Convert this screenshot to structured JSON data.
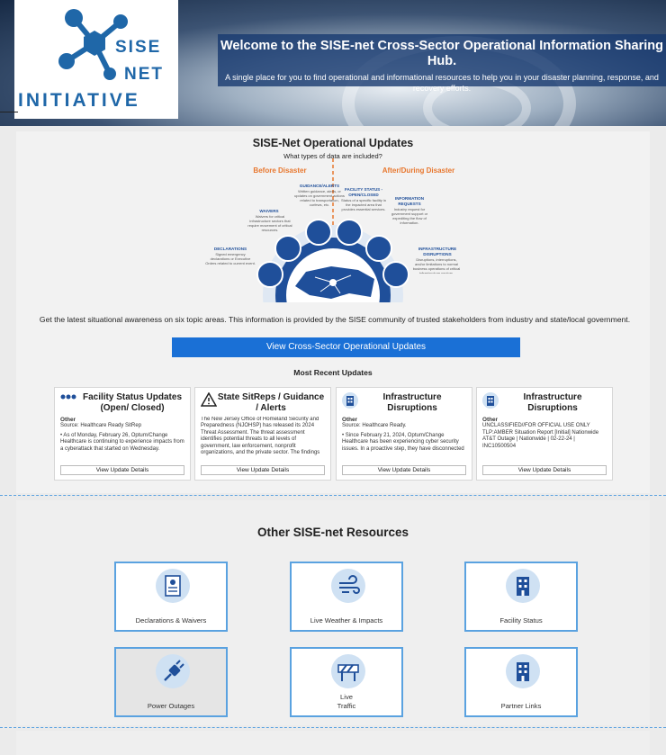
{
  "header": {
    "logo_line1": "SISE",
    "logo_line2": "NET",
    "logo_line3": "INITIATIVE",
    "title": "Welcome to the SISE-net Cross-Sector Operational Information Sharing Hub.",
    "subtitle": "A single place for you to find operational and informational resources to help you in your disaster planning, response, and recovery efforts."
  },
  "updates": {
    "title": "SISE-Net Operational Updates",
    "question": "What types of data are included?",
    "before_label": "Before Disaster",
    "after_label": "After/During Disaster",
    "topics": [
      {
        "name": "GUIDANCE/ALERTS",
        "desc": "Written guidance, alerts, or updates on government actions related to transportation, curfews, etc."
      },
      {
        "name": "WAIVERS",
        "desc": "Waivers for critical infrastructure sectors that require movement of critical resources."
      },
      {
        "name": "DECLARATIONS",
        "desc": "Signed emergency declarations or Executive Orders related to current event."
      },
      {
        "name": "FACILITY STATUS - OPEN/CLOSED",
        "desc": "Status of a specific facility in the impacted area that provides essential services."
      },
      {
        "name": "INFORMATION REQUESTS",
        "desc": "Industry request for government support or expediting the flow of information."
      },
      {
        "name": "INFRASTRUCTURE DISRUPTIONS",
        "desc": "Disruptions, interruptions, and/or limitations to normal business operations of critical infrastructure sectors."
      }
    ],
    "description": "Get the latest situational awareness on six topic areas. This information is provided by the SISE community of trusted stakeholders from industry and state/local government.",
    "cta_label": "View Cross-Sector Operational Updates",
    "recent_title": "Most Recent Updates"
  },
  "cards": [
    {
      "icon": "facility-status-icon",
      "title": "Facility Status Updates (Open/ Closed)",
      "category": "Other",
      "source": "Source: Healthcare Ready SitRep",
      "body": "• As of Monday, February 26, Optum/Change Healthcare is continuing to experience impacts from a cyberattack that started on Wednesday.",
      "button": "View Update Details"
    },
    {
      "icon": "warning-triangle-icon",
      "title": "State SitReps / Guidance / Alerts",
      "category": "",
      "source": "",
      "body": "The New Jersey Office of Homeland Security and Preparedness (NJOHSP) has released its 2024 Threat Assessment. The threat assessment identifies potential threats to all levels of government, law enforcement, nonprofit organizations, and the private sector. The findings",
      "button": "View Update Details"
    },
    {
      "icon": "building-icon",
      "title": "Infrastructure Disruptions",
      "category": "Other",
      "source": "Source: Healthcare Ready.",
      "body": "• Since February 21, 2024, Optum/Change Healthcare has been experiencing cyber security issues. In a proactive step, they have disconnected",
      "button": "View Update Details"
    },
    {
      "icon": "building-icon",
      "title": "Infrastructure Disruptions",
      "category": "Other",
      "source": "UNCLASSIFIED//FOR OFFICIAL USE ONLY",
      "body": "TLP:AMBER Situation Report [Initial] Nationwide AT&T Outage | Nationwide | 02-22-24 | INC10500504",
      "button": "View Update Details"
    }
  ],
  "resources": {
    "title": "Other SISE-net Resources",
    "tiles": [
      {
        "label": "Declarations & Waivers",
        "icon": "document-icon"
      },
      {
        "label": "Live Weather & Impacts",
        "icon": "weather-wind-icon"
      },
      {
        "label": "Facility Status",
        "icon": "building-icon"
      },
      {
        "label": "Power Outages",
        "icon": "power-plug-icon"
      },
      {
        "label": "Live Traffic",
        "icon": "traffic-barrier-icon"
      },
      {
        "label": "Partner Links",
        "icon": "building-icon"
      }
    ]
  },
  "colors": {
    "accent": "#1a70d6",
    "orange": "#e8772e",
    "dark_blue": "#1f4f9a",
    "tile_border": "#5aa2e0"
  }
}
